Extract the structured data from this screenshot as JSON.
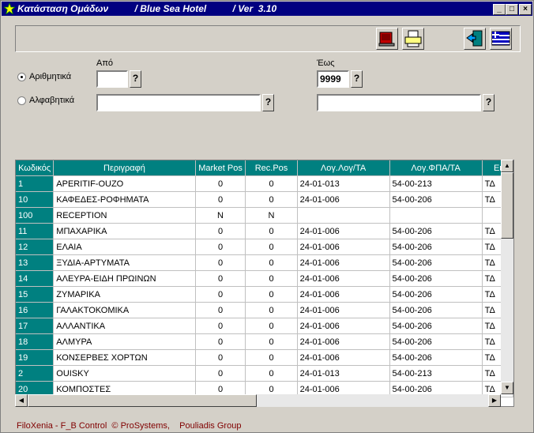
{
  "window": {
    "title": "Κατάσταση Ομάδων          / Blue Sea Hotel          / Ver  3.10",
    "minimize": "_",
    "maximize": "□",
    "close": "×"
  },
  "filters": {
    "from_label": "Από",
    "to_label": "Έως",
    "numeric_label": "Αριθμητικά",
    "alpha_label": "Αλφαβητικά",
    "numeric_from_value": "",
    "numeric_to_value": "9999",
    "alpha_from_value": "",
    "alpha_to_value": "",
    "lookup_label": "?"
  },
  "table": {
    "columns": [
      "Κωδικός",
      "Περιγραφή",
      "Market Pos",
      "Rec.Pos",
      "Λογ.Λογ/ΤΑ",
      "Λογ.ΦΠΑ/ΤΑ",
      "Ει"
    ],
    "rows": [
      [
        "1",
        "APERITIF-OUZO",
        "0",
        "0",
        "24-01-013",
        "54-00-213",
        "ΤΔ"
      ],
      [
        "10",
        "ΚΑΦΕΔΕΣ-ΡΟΦΗΜΑΤΑ",
        "0",
        "0",
        "24-01-006",
        "54-00-206",
        "ΤΔ"
      ],
      [
        "100",
        "RECEPTION",
        "N",
        "N",
        "",
        "",
        ""
      ],
      [
        "11",
        "ΜΠΑΧΑΡΙΚΑ",
        "0",
        "0",
        "24-01-006",
        "54-00-206",
        "ΤΔ"
      ],
      [
        "12",
        "ΕΛΑΙΑ",
        "0",
        "0",
        "24-01-006",
        "54-00-206",
        "ΤΔ"
      ],
      [
        "13",
        "ΞΥΔΙΑ-ΑΡΤΥΜΑΤΑ",
        "0",
        "0",
        "24-01-006",
        "54-00-206",
        "ΤΔ"
      ],
      [
        "14",
        "ΑΛΕΥΡΑ-ΕΙΔΗ ΠΡΩΙΝΩΝ",
        "0",
        "0",
        "24-01-006",
        "54-00-206",
        "ΤΔ"
      ],
      [
        "15",
        "ΖΥΜΑΡΙΚΑ",
        "0",
        "0",
        "24-01-006",
        "54-00-206",
        "ΤΔ"
      ],
      [
        "16",
        "ΓΑΛΑΚΤΟΚΟΜΙΚΑ",
        "0",
        "0",
        "24-01-006",
        "54-00-206",
        "ΤΔ"
      ],
      [
        "17",
        "ΑΛΛΑΝΤΙΚΑ",
        "0",
        "0",
        "24-01-006",
        "54-00-206",
        "ΤΔ"
      ],
      [
        "18",
        "ΑΛΜΥΡΑ",
        "0",
        "0",
        "24-01-006",
        "54-00-206",
        "ΤΔ"
      ],
      [
        "19",
        "ΚΟΝΣΕΡΒΕΣ ΧΟΡΤΩΝ",
        "0",
        "0",
        "24-01-006",
        "54-00-206",
        "ΤΔ"
      ],
      [
        "2",
        "OUISKY",
        "0",
        "0",
        "24-01-013",
        "54-00-213",
        "ΤΔ"
      ],
      [
        "20",
        "ΚΟΜΠΟΣΤΕΣ",
        "0",
        "0",
        "24-01-006",
        "54-00-206",
        "ΤΔ"
      ]
    ]
  },
  "footer": {
    "text": "FiloXenia - F_B Control  © ProSystems,    Pouliadis Group"
  },
  "icons": {
    "app": "star-icon",
    "preview": "print-preview-icon",
    "print": "printer-icon",
    "exit": "exit-door-icon",
    "language": "greek-flag-icon"
  },
  "colors": {
    "title_bg": "#000080",
    "grid_header": "#008080",
    "footer_text": "#800000"
  }
}
